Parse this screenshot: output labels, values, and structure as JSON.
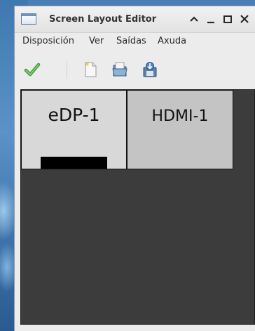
{
  "window": {
    "title": "Screen Layout Editor",
    "controls": {
      "minimize_up_glyph": "^",
      "minimize_glyph": "_",
      "maximize_glyph": "□",
      "close_glyph": "✕"
    }
  },
  "menubar": {
    "items": [
      {
        "label": "Disposición"
      },
      {
        "label": "Ver"
      },
      {
        "label": "Saídas"
      },
      {
        "label": "Axuda"
      }
    ]
  },
  "toolbar": {
    "buttons": [
      {
        "icon": "checkmark-icon"
      },
      {
        "icon": "new-document-icon"
      },
      {
        "icon": "open-folder-icon"
      },
      {
        "icon": "save-disk-icon"
      }
    ]
  },
  "layout": {
    "monitors": [
      {
        "name": "eDP-1",
        "primary": true
      },
      {
        "name": "HDMI-1",
        "primary": false
      }
    ]
  },
  "colors": {
    "canvas_background": "#3c3c3c",
    "monitor_edp": "#d8d8d8",
    "monitor_hdmi": "#c4c4c4",
    "check_green": "#4caf50"
  }
}
